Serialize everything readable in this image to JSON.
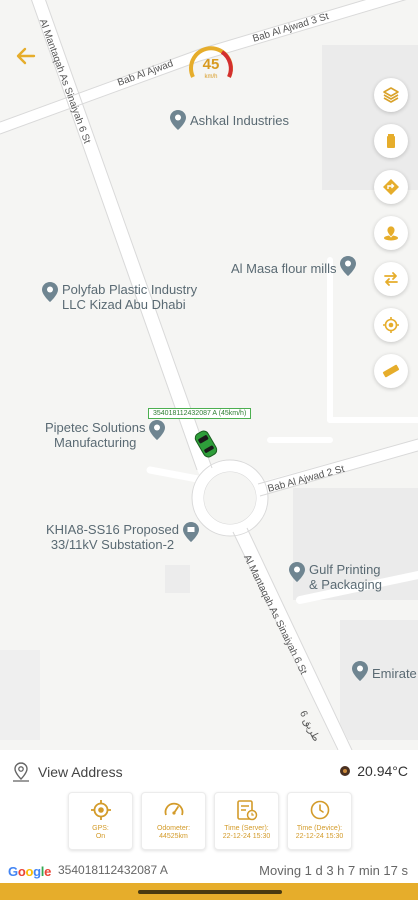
{
  "map": {
    "roads": {
      "top_right": "Bab Al Ajwad 3 St",
      "top_left": "Bab Al Ajwad",
      "diagonal_north": "Al Mantaqah As Sinaiyah 6 St",
      "east": "Bab Al Ajwad 2 St",
      "diagonal_south": "Al Mantaqah As Sinaiyah 6 St",
      "arabic": "طريق 6"
    },
    "pois": [
      {
        "name": "Ashkal Industries"
      },
      {
        "name": "Al Masa flour mills"
      },
      {
        "name": "Polyfab Plastic Industry\nLLC Kizad Abu Dhabi"
      },
      {
        "name": "Pipetec Solutions\nManufacturing"
      },
      {
        "name": "KHIA8-SS16 Proposed\n33/11kV Substation-2"
      },
      {
        "name": "Gulf Printing\n& Packaging"
      },
      {
        "name": "Emirate"
      }
    ],
    "speed": {
      "value": "45",
      "unit": "km/h"
    },
    "vehicle_label": "354018112432087 A (45km/h)",
    "side_buttons": [
      {
        "icon": "layers-icon"
      },
      {
        "icon": "battery-icon"
      },
      {
        "icon": "direction-icon"
      },
      {
        "icon": "geofence-icon"
      },
      {
        "icon": "swap-icon"
      },
      {
        "icon": "locate-icon"
      },
      {
        "icon": "ruler-icon"
      }
    ],
    "accent": "#e6ad2b"
  },
  "bottom": {
    "view_address": "View Address",
    "temperature": "20.94°C",
    "tiles": [
      {
        "icon": "gps-icon",
        "label": "GPS:\nOn"
      },
      {
        "icon": "odometer-icon",
        "label": "Odometer:\n44525km"
      },
      {
        "icon": "server-time-icon",
        "label": "Time (Server):\n22-12-24 15:30"
      },
      {
        "icon": "device-time-icon",
        "label": "Time (Device):\n22-12-24 15:30"
      }
    ],
    "google": "Google",
    "imei": "354018112432087 A",
    "status": "Moving 1 d 3 h 7 min 17 s"
  }
}
